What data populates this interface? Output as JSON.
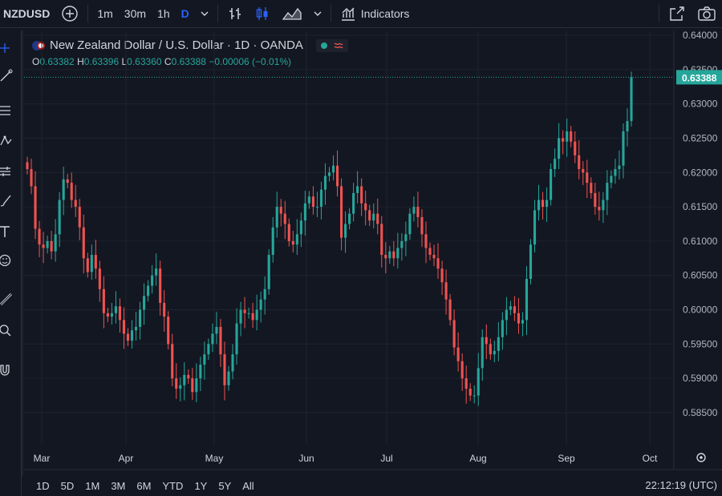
{
  "toolbar": {
    "symbol": "NZDUSD",
    "intervals": [
      "1m",
      "30m",
      "1h",
      "D"
    ],
    "active_interval": "D",
    "indicators_label": "Indicators"
  },
  "legend": {
    "title": "New Zealand Dollar / U.S. Dollar · 1D · OANDA",
    "open_key": "O",
    "open": "0.63382",
    "high_key": "H",
    "high": "0.63396",
    "low_key": "L",
    "low": "0.63360",
    "close_key": "C",
    "close": "0.63388",
    "change": "−0.00006 (−0.01%)"
  },
  "colors": {
    "up": "#26a69a",
    "down": "#ef5350",
    "background": "#131722",
    "grid": "#1f2330",
    "text": "#d1d4dc",
    "accent": "#2962ff"
  },
  "price_axis": {
    "labels": [
      "0.64000",
      "0.63500",
      "0.63000",
      "0.62500",
      "0.62000",
      "0.61500",
      "0.61000",
      "0.60500",
      "0.60000",
      "0.59500",
      "0.59000",
      "0.58500"
    ],
    "current_price": "0.63388"
  },
  "time_axis": {
    "labels": [
      "Mar",
      "Apr",
      "May",
      "Jun",
      "Jul",
      "Aug",
      "Sep",
      "Oct"
    ]
  },
  "bottom": {
    "ranges": [
      "1D",
      "5D",
      "1M",
      "3M",
      "6M",
      "YTD",
      "1Y",
      "5Y",
      "All"
    ],
    "clock": "22:12:19 (UTC)"
  },
  "chart_data": {
    "type": "candlestick",
    "ylim": [
      0.585,
      0.64
    ],
    "closes": [
      0.6205,
      0.618,
      0.6118,
      0.6095,
      0.609,
      0.61,
      0.6085,
      0.611,
      0.616,
      0.619,
      0.6185,
      0.616,
      0.615,
      0.612,
      0.6075,
      0.6055,
      0.608,
      0.606,
      0.603,
      0.5995,
      0.599,
      0.5995,
      0.6005,
      0.5985,
      0.5965,
      0.5955,
      0.597,
      0.5975,
      0.6,
      0.602,
      0.6035,
      0.605,
      0.606,
      0.601,
      0.599,
      0.595,
      0.59,
      0.5885,
      0.589,
      0.5905,
      0.59,
      0.588,
      0.59,
      0.592,
      0.5935,
      0.595,
      0.5965,
      0.5975,
      0.5935,
      0.589,
      0.591,
      0.5935,
      0.598,
      0.6,
      0.5995,
      0.5995,
      0.5985,
      0.6,
      0.6015,
      0.603,
      0.608,
      0.612,
      0.615,
      0.614,
      0.6125,
      0.61,
      0.6095,
      0.611,
      0.613,
      0.6155,
      0.6165,
      0.615,
      0.615,
      0.6175,
      0.6195,
      0.62,
      0.621,
      0.618,
      0.6105,
      0.6125,
      0.614,
      0.617,
      0.618,
      0.6155,
      0.6145,
      0.613,
      0.614,
      0.6125,
      0.608,
      0.6075,
      0.6085,
      0.6075,
      0.609,
      0.61,
      0.611,
      0.614,
      0.615,
      0.6135,
      0.611,
      0.609,
      0.608,
      0.6075,
      0.606,
      0.604,
      0.6015,
      0.5985,
      0.5945,
      0.5925,
      0.59,
      0.5885,
      0.5875,
      0.5875,
      0.5915,
      0.596,
      0.595,
      0.5935,
      0.594,
      0.596,
      0.5985,
      0.6,
      0.6005,
      0.5995,
      0.598,
      0.5985,
      0.6045,
      0.6095,
      0.6145,
      0.616,
      0.615,
      0.616,
      0.6205,
      0.622,
      0.625,
      0.6245,
      0.626,
      0.6245,
      0.6225,
      0.6205,
      0.62,
      0.6185,
      0.617,
      0.615,
      0.6145,
      0.616,
      0.6185,
      0.6195,
      0.6205,
      0.621,
      0.626,
      0.6275,
      0.6339
    ]
  }
}
